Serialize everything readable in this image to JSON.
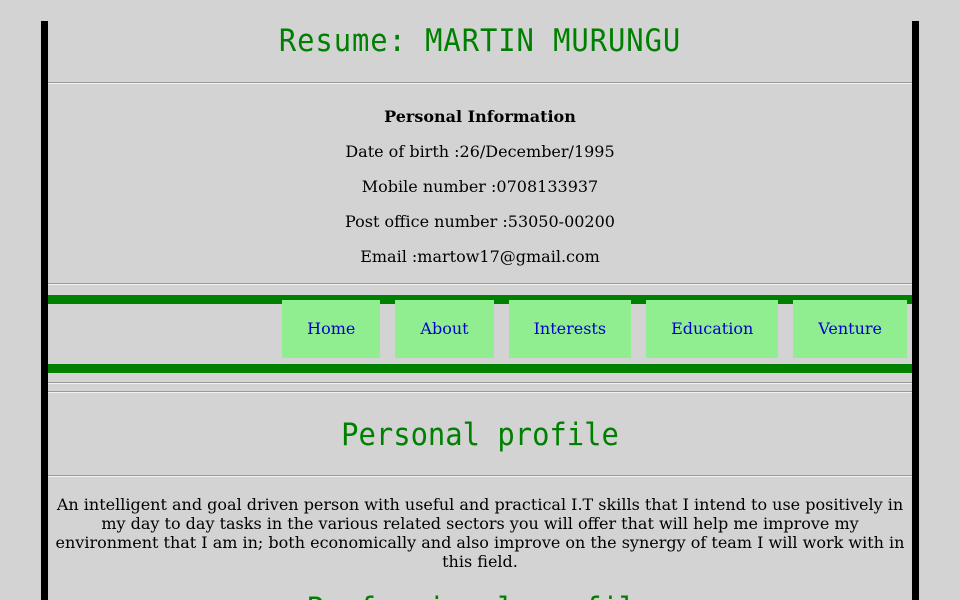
{
  "resume": {
    "title": "Resume: MARTIN MURUNGU"
  },
  "personal_info": {
    "heading": "Personal Information",
    "lines": [
      "Date of birth :26/December/1995",
      "Mobile number :0708133937",
      "Post office number :53050-00200",
      "Email :martow17@gmail.com"
    ]
  },
  "nav": {
    "items": [
      "Home",
      "About",
      "Interests",
      "Education",
      "Venture"
    ]
  },
  "profile": {
    "title": "Personal profile",
    "text": "An intelligent and goal driven person with useful and practical I.T skills that I intend to use positively in my day to day tasks in the various related sectors you will offer that will help me improve my environment that I am in; both economically and also improve on the synergy of team I will work with in this field."
  },
  "professional": {
    "title": "Professional profile"
  },
  "colors": {
    "heading": "#008000",
    "nav_bg": "#90ee90",
    "nav_link": "#0000cd",
    "background": "#d3d3d3"
  }
}
